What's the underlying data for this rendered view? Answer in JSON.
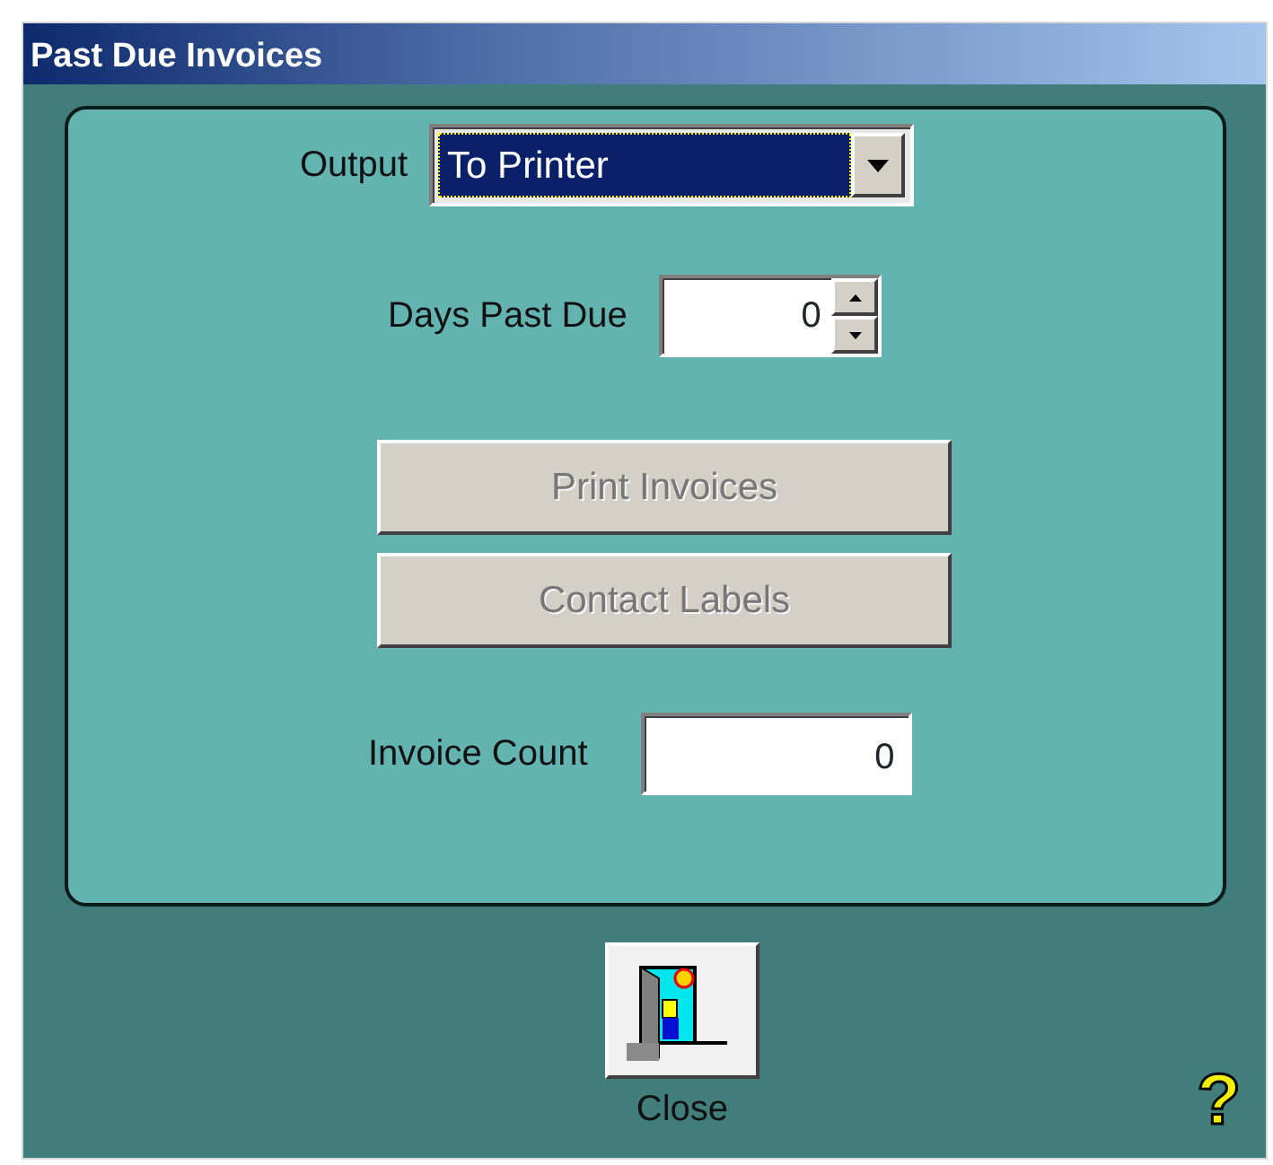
{
  "window": {
    "title": "Past Due Invoices"
  },
  "output": {
    "label": "Output",
    "value": "To Printer",
    "focused": true
  },
  "days_past_due": {
    "label": "Days Past Due",
    "value": "0"
  },
  "buttons": [
    {
      "label": "Print Invoices",
      "disabled": true
    },
    {
      "label": "Contact Labels",
      "disabled": true
    }
  ],
  "invoice_count": {
    "label": "Invoice Count",
    "value": "0"
  },
  "close_button": {
    "label": "Close"
  },
  "help": "?"
}
